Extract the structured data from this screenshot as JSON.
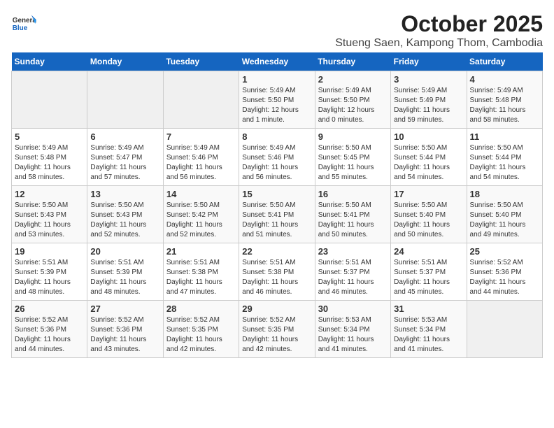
{
  "header": {
    "logo_general": "General",
    "logo_blue": "Blue",
    "month": "October 2025",
    "location": "Stueng Saen, Kampong Thom, Cambodia"
  },
  "days_of_week": [
    "Sunday",
    "Monday",
    "Tuesday",
    "Wednesday",
    "Thursday",
    "Friday",
    "Saturday"
  ],
  "weeks": [
    [
      {
        "day": "",
        "info": ""
      },
      {
        "day": "",
        "info": ""
      },
      {
        "day": "",
        "info": ""
      },
      {
        "day": "1",
        "info": "Sunrise: 5:49 AM\nSunset: 5:50 PM\nDaylight: 12 hours\nand 1 minute."
      },
      {
        "day": "2",
        "info": "Sunrise: 5:49 AM\nSunset: 5:50 PM\nDaylight: 12 hours\nand 0 minutes."
      },
      {
        "day": "3",
        "info": "Sunrise: 5:49 AM\nSunset: 5:49 PM\nDaylight: 11 hours\nand 59 minutes."
      },
      {
        "day": "4",
        "info": "Sunrise: 5:49 AM\nSunset: 5:48 PM\nDaylight: 11 hours\nand 58 minutes."
      }
    ],
    [
      {
        "day": "5",
        "info": "Sunrise: 5:49 AM\nSunset: 5:48 PM\nDaylight: 11 hours\nand 58 minutes."
      },
      {
        "day": "6",
        "info": "Sunrise: 5:49 AM\nSunset: 5:47 PM\nDaylight: 11 hours\nand 57 minutes."
      },
      {
        "day": "7",
        "info": "Sunrise: 5:49 AM\nSunset: 5:46 PM\nDaylight: 11 hours\nand 56 minutes."
      },
      {
        "day": "8",
        "info": "Sunrise: 5:49 AM\nSunset: 5:46 PM\nDaylight: 11 hours\nand 56 minutes."
      },
      {
        "day": "9",
        "info": "Sunrise: 5:50 AM\nSunset: 5:45 PM\nDaylight: 11 hours\nand 55 minutes."
      },
      {
        "day": "10",
        "info": "Sunrise: 5:50 AM\nSunset: 5:44 PM\nDaylight: 11 hours\nand 54 minutes."
      },
      {
        "day": "11",
        "info": "Sunrise: 5:50 AM\nSunset: 5:44 PM\nDaylight: 11 hours\nand 54 minutes."
      }
    ],
    [
      {
        "day": "12",
        "info": "Sunrise: 5:50 AM\nSunset: 5:43 PM\nDaylight: 11 hours\nand 53 minutes."
      },
      {
        "day": "13",
        "info": "Sunrise: 5:50 AM\nSunset: 5:43 PM\nDaylight: 11 hours\nand 52 minutes."
      },
      {
        "day": "14",
        "info": "Sunrise: 5:50 AM\nSunset: 5:42 PM\nDaylight: 11 hours\nand 52 minutes."
      },
      {
        "day": "15",
        "info": "Sunrise: 5:50 AM\nSunset: 5:41 PM\nDaylight: 11 hours\nand 51 minutes."
      },
      {
        "day": "16",
        "info": "Sunrise: 5:50 AM\nSunset: 5:41 PM\nDaylight: 11 hours\nand 50 minutes."
      },
      {
        "day": "17",
        "info": "Sunrise: 5:50 AM\nSunset: 5:40 PM\nDaylight: 11 hours\nand 50 minutes."
      },
      {
        "day": "18",
        "info": "Sunrise: 5:50 AM\nSunset: 5:40 PM\nDaylight: 11 hours\nand 49 minutes."
      }
    ],
    [
      {
        "day": "19",
        "info": "Sunrise: 5:51 AM\nSunset: 5:39 PM\nDaylight: 11 hours\nand 48 minutes."
      },
      {
        "day": "20",
        "info": "Sunrise: 5:51 AM\nSunset: 5:39 PM\nDaylight: 11 hours\nand 48 minutes."
      },
      {
        "day": "21",
        "info": "Sunrise: 5:51 AM\nSunset: 5:38 PM\nDaylight: 11 hours\nand 47 minutes."
      },
      {
        "day": "22",
        "info": "Sunrise: 5:51 AM\nSunset: 5:38 PM\nDaylight: 11 hours\nand 46 minutes."
      },
      {
        "day": "23",
        "info": "Sunrise: 5:51 AM\nSunset: 5:37 PM\nDaylight: 11 hours\nand 46 minutes."
      },
      {
        "day": "24",
        "info": "Sunrise: 5:51 AM\nSunset: 5:37 PM\nDaylight: 11 hours\nand 45 minutes."
      },
      {
        "day": "25",
        "info": "Sunrise: 5:52 AM\nSunset: 5:36 PM\nDaylight: 11 hours\nand 44 minutes."
      }
    ],
    [
      {
        "day": "26",
        "info": "Sunrise: 5:52 AM\nSunset: 5:36 PM\nDaylight: 11 hours\nand 44 minutes."
      },
      {
        "day": "27",
        "info": "Sunrise: 5:52 AM\nSunset: 5:36 PM\nDaylight: 11 hours\nand 43 minutes."
      },
      {
        "day": "28",
        "info": "Sunrise: 5:52 AM\nSunset: 5:35 PM\nDaylight: 11 hours\nand 42 minutes."
      },
      {
        "day": "29",
        "info": "Sunrise: 5:52 AM\nSunset: 5:35 PM\nDaylight: 11 hours\nand 42 minutes."
      },
      {
        "day": "30",
        "info": "Sunrise: 5:53 AM\nSunset: 5:34 PM\nDaylight: 11 hours\nand 41 minutes."
      },
      {
        "day": "31",
        "info": "Sunrise: 5:53 AM\nSunset: 5:34 PM\nDaylight: 11 hours\nand 41 minutes."
      },
      {
        "day": "",
        "info": ""
      }
    ]
  ]
}
